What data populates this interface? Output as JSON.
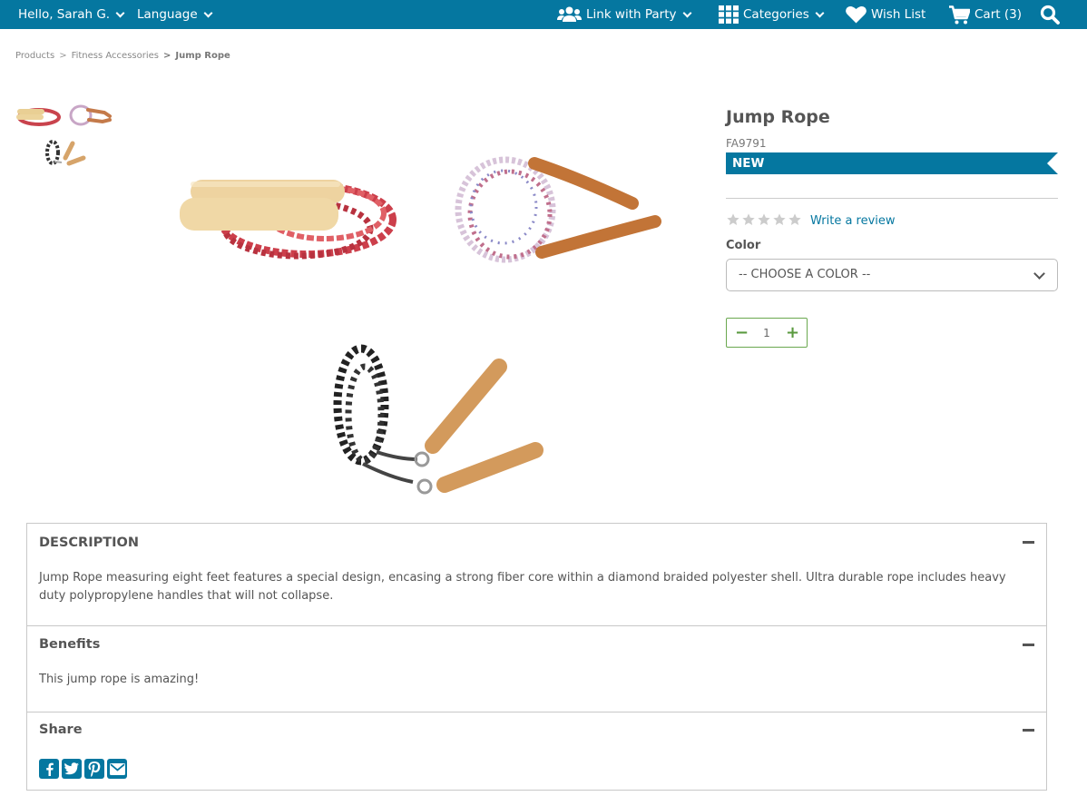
{
  "topbar": {
    "greeting": "Hello, Sarah G.",
    "language": "Language",
    "link_party": "Link with Party",
    "categories": "Categories",
    "wishlist": "Wish List",
    "cart": "Cart (3)"
  },
  "breadcrumb": {
    "items": [
      "Products",
      "Fitness Accessories",
      "Jump Rope"
    ],
    "separator": ">"
  },
  "product": {
    "title": "Jump Rope",
    "sku": "FA9791",
    "badge": "NEW",
    "rating": 0,
    "review_link": "Write a review",
    "color_label": "Color",
    "color_select": "-- CHOOSE A COLOR --",
    "quantity": "1",
    "minus": "−",
    "plus": "+"
  },
  "accordion": {
    "description": {
      "title": "DESCRIPTION",
      "body": "Jump Rope measuring eight feet features a special design, encasing a strong fiber core within a diamond braided polyester shell. Ultra durable rope includes heavy duty polypropylene handles that will not collapse."
    },
    "benefits": {
      "title": "Benefits",
      "body": "This jump rope is amazing!"
    },
    "share": {
      "title": "Share",
      "icons": [
        "facebook-icon",
        "twitter-icon",
        "pinterest-icon",
        "email-icon"
      ]
    }
  },
  "colors": {
    "brand": "#0577a0",
    "accent_green": "#6aa84f",
    "star_gray": "#cccccc"
  }
}
